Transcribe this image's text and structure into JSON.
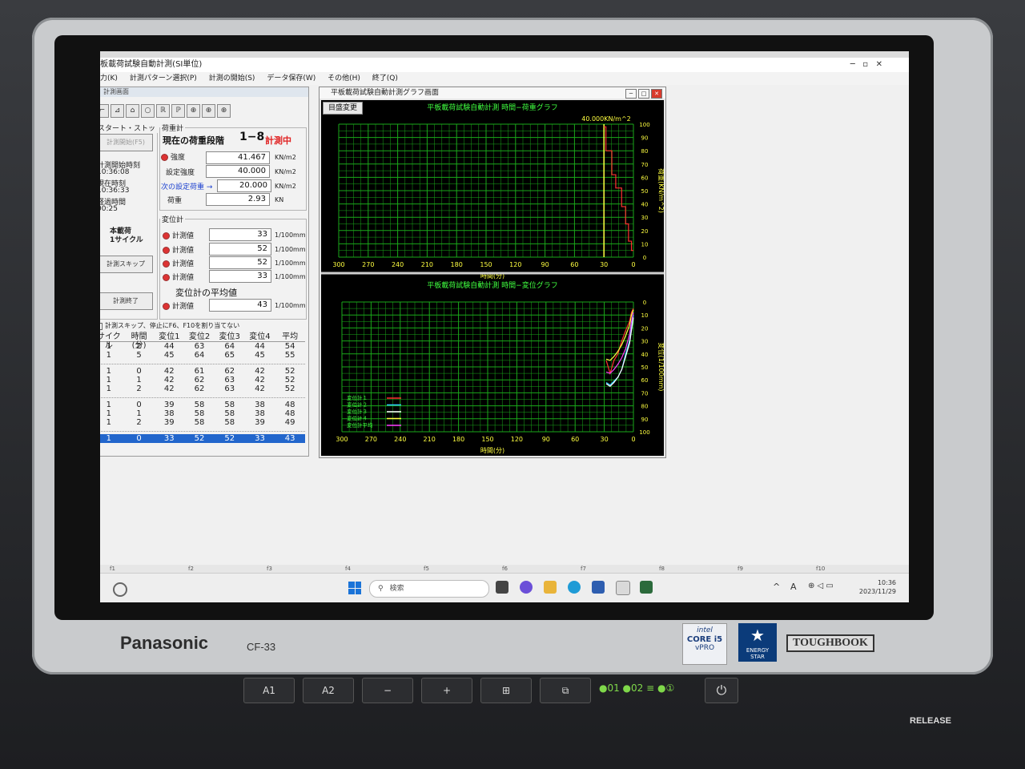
{
  "device": {
    "brand": "Panasonic",
    "model": "CF-33",
    "intel_badge": [
      "intel",
      "CORE i5",
      "vPRO"
    ],
    "energy_star": "ENERGY STAR",
    "series": "TOUGHBOOK",
    "keys": [
      "A1",
      "A2",
      "−",
      "+",
      "⊞",
      "⧉"
    ],
    "indicators": "●01 ●02 ≡ ●①",
    "release_label": "RELEASE"
  },
  "window": {
    "title": "平板載荷試験自動計測(SI単位)",
    "menu": [
      "項目入力(K)",
      "計測パターン選択(P)",
      "計測の開始(S)",
      "データ保存(W)",
      "その他(H)",
      "終了(Q)"
    ]
  },
  "left_panel": {
    "title": "計測画面",
    "tools": [
      "⌐",
      "⊿",
      "⌂",
      "○",
      "ℝ",
      "ℙ",
      "⊕",
      "⊕",
      "⊕"
    ],
    "start_stop": {
      "legend": "スタート・ストップ",
      "start_button": "計測開始(F5)",
      "start_time_label": "計測開始時刻",
      "start_time": "10:36:08",
      "now_label": "現在時刻",
      "now_time": "10:36:33",
      "elapsed_label": "経過時間",
      "elapsed": "00:25",
      "mode_line1": "本載荷",
      "mode_line2": "1サイクル",
      "skip_button": "計測スキップ",
      "end_button": "計測終了"
    },
    "load": {
      "legend": "荷重計",
      "stage_label": "現在の荷重段階",
      "stage": "1−8",
      "status": "計測中",
      "strength_label": "強度",
      "strength": "41.467",
      "strength_unit": "KN/m2",
      "set_label": "設定強度",
      "set": "40.000",
      "set_unit": "KN/m2",
      "next_label": "次の設定荷重 →",
      "next": "20.000",
      "next_unit": "KN/m2",
      "load_label": "荷重",
      "load": "2.93",
      "load_unit": "KN"
    },
    "displacement": {
      "legend": "変位計",
      "items": [
        {
          "label": "計測値",
          "value": "33",
          "unit": "1/100mm"
        },
        {
          "label": "計測値",
          "value": "52",
          "unit": "1/100mm"
        },
        {
          "label": "計測値",
          "value": "52",
          "unit": "1/100mm"
        },
        {
          "label": "計測値",
          "value": "33",
          "unit": "1/100mm"
        }
      ],
      "avg_title": "変位計の平均値",
      "avg_label": "計測値",
      "avg_value": "43",
      "avg_unit": "1/100mm"
    },
    "skip_check": "計測スキップ、停止にF6、F10を割り当てない",
    "table": {
      "headers": [
        "サイクル",
        "時間(分)",
        "変位1",
        "変位2",
        "変位3",
        "変位4",
        "平均"
      ],
      "groups": [
        [
          [
            "1",
            "2",
            "44",
            "63",
            "64",
            "44",
            "54"
          ],
          [
            "1",
            "5",
            "45",
            "64",
            "65",
            "45",
            "55"
          ]
        ],
        [
          [
            "1",
            "0",
            "42",
            "61",
            "62",
            "42",
            "52"
          ],
          [
            "1",
            "1",
            "42",
            "62",
            "63",
            "42",
            "52"
          ],
          [
            "1",
            "2",
            "42",
            "62",
            "63",
            "42",
            "52"
          ]
        ],
        [
          [
            "1",
            "0",
            "39",
            "58",
            "58",
            "38",
            "48"
          ],
          [
            "1",
            "1",
            "38",
            "58",
            "58",
            "38",
            "48"
          ],
          [
            "1",
            "2",
            "39",
            "58",
            "58",
            "39",
            "49"
          ]
        ]
      ],
      "current": [
        "1",
        "0",
        "33",
        "52",
        "52",
        "33",
        "43"
      ]
    }
  },
  "graph_window": {
    "title": "平板載荷試験自動計測グラフ画面",
    "change_button": "目盛変更",
    "top": {
      "title": "平板載荷試験自動計測 時間−荷重グラフ",
      "max_label": "40.000KN/m^2",
      "ylabel": "荷重(KN/m^2)",
      "xlabel": "時間(分)",
      "xticks": [
        "300",
        "270",
        "240",
        "210",
        "180",
        "150",
        "120",
        "90",
        "60",
        "30",
        "0"
      ],
      "yticks": [
        "0",
        "10",
        "20",
        "30",
        "40",
        "50",
        "60",
        "70",
        "80",
        "90",
        "100"
      ]
    },
    "bottom": {
      "title": "平板載荷試験自動計測 時間−変位グラフ",
      "ylabel": "変位(1/100mm)",
      "xlabel": "時間(分)",
      "xticks": [
        "300",
        "270",
        "240",
        "210",
        "180",
        "150",
        "120",
        "90",
        "60",
        "30",
        "0"
      ],
      "yticks": [
        "0",
        "10",
        "20",
        "30",
        "40",
        "50",
        "60",
        "70",
        "80",
        "90",
        "100"
      ],
      "legend": [
        {
          "name": "変位計１",
          "color": "#ff3030"
        },
        {
          "name": "変位計２",
          "color": "#30d0ff"
        },
        {
          "name": "変位計３",
          "color": "#ffffff"
        },
        {
          "name": "変位計４",
          "color": "#ffff40"
        },
        {
          "name": "変位計平均",
          "color": "#ff40ff"
        }
      ]
    }
  },
  "chart_data": [
    {
      "type": "line",
      "title": "平板載荷試験自動計測 時間−荷重グラフ",
      "xlabel": "時間(分)",
      "ylabel": "荷重(KN/m^2)",
      "xlim": [
        300,
        0
      ],
      "ylim": [
        0,
        100
      ],
      "series": [
        {
          "name": "",
          "color": "#ff3030",
          "x": [
            0,
            2,
            2,
            5,
            5,
            8,
            8,
            12,
            12,
            18,
            18,
            22,
            22,
            28,
            28,
            30
          ],
          "y": [
            5,
            5,
            12,
            12,
            25,
            25,
            38,
            38,
            52,
            52,
            62,
            62,
            80,
            80,
            98,
            98
          ]
        }
      ],
      "markers": [
        {
          "x": 30,
          "color": "#ffff40"
        }
      ]
    },
    {
      "type": "line",
      "title": "平板載荷試験自動計測 時間−変位グラフ",
      "xlabel": "時間(分)",
      "ylabel": "変位(1/100mm)",
      "xlim": [
        300,
        0
      ],
      "ylim": [
        0,
        100
      ],
      "series": [
        {
          "name": "変位計１",
          "color": "#ff3030",
          "x": [
            28,
            24,
            20,
            16,
            12,
            8,
            4,
            2,
            0
          ],
          "y": [
            45,
            55,
            45,
            40,
            30,
            22,
            15,
            8,
            5
          ]
        },
        {
          "name": "変位計２",
          "color": "#30d0ff",
          "x": [
            28,
            24,
            20,
            16,
            12,
            8,
            4,
            2,
            0
          ],
          "y": [
            62,
            64,
            61,
            58,
            52,
            40,
            30,
            20,
            10
          ]
        },
        {
          "name": "変位計３",
          "color": "#ffffff",
          "x": [
            28,
            24,
            20,
            16,
            12,
            8,
            4,
            2,
            0
          ],
          "y": [
            63,
            65,
            62,
            58,
            52,
            42,
            32,
            22,
            12
          ]
        },
        {
          "name": "変位計４",
          "color": "#ffff40",
          "x": [
            28,
            24,
            20,
            16,
            12,
            8,
            4,
            2,
            0
          ],
          "y": [
            44,
            45,
            42,
            38,
            33,
            26,
            18,
            10,
            6
          ]
        },
        {
          "name": "変位計平均",
          "color": "#ff40ff",
          "x": [
            28,
            24,
            20,
            16,
            12,
            8,
            4,
            2,
            0
          ],
          "y": [
            54,
            55,
            52,
            48,
            43,
            36,
            25,
            15,
            8
          ]
        }
      ]
    }
  ],
  "taskbar": {
    "fkeys": [
      "f1",
      "f2",
      "f3",
      "f4",
      "f5",
      "f6",
      "f7",
      "f8",
      "f9",
      "f10"
    ],
    "search_placeholder": "検索",
    "time": "10:36",
    "date": "2023/11/29",
    "ime": "A"
  }
}
